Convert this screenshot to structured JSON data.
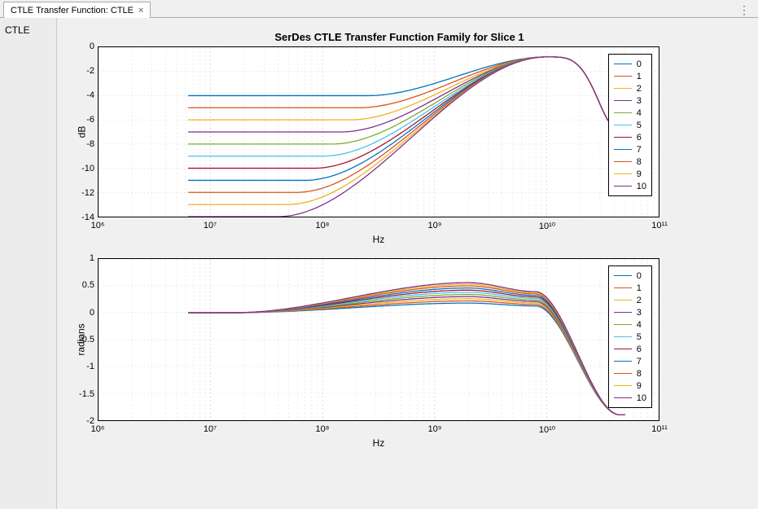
{
  "tab": {
    "title": "CTLE Transfer Function: CTLE"
  },
  "sidebar": {
    "label": "CTLE"
  },
  "title": "SerDes CTLE Transfer Function Family for Slice 1",
  "ylabel_top": "dB",
  "ylabel_bot": "radians",
  "xlabel": "Hz",
  "yticks_top": [
    {
      "v": 0,
      "lbl": "0"
    },
    {
      "v": -2,
      "lbl": "-2"
    },
    {
      "v": -4,
      "lbl": "-4"
    },
    {
      "v": -6,
      "lbl": "-6"
    },
    {
      "v": -8,
      "lbl": "-8"
    },
    {
      "v": -10,
      "lbl": "-10"
    },
    {
      "v": -12,
      "lbl": "-12"
    },
    {
      "v": -14,
      "lbl": "-14"
    }
  ],
  "yticks_bot": [
    {
      "v": 1,
      "lbl": "1"
    },
    {
      "v": 0.5,
      "lbl": "0.5"
    },
    {
      "v": 0,
      "lbl": "0"
    },
    {
      "v": -0.5,
      "lbl": "-0.5"
    },
    {
      "v": -1,
      "lbl": "-1"
    },
    {
      "v": -1.5,
      "lbl": "-1.5"
    },
    {
      "v": -2,
      "lbl": "-2"
    }
  ],
  "xticks": [
    {
      "e": 6,
      "lbl": "10⁶"
    },
    {
      "e": 7,
      "lbl": "10⁷"
    },
    {
      "e": 8,
      "lbl": "10⁸"
    },
    {
      "e": 9,
      "lbl": "10⁹"
    },
    {
      "e": 10,
      "lbl": "10¹⁰"
    },
    {
      "e": 11,
      "lbl": "10¹¹"
    }
  ],
  "legend": [
    "0",
    "1",
    "2",
    "3",
    "4",
    "5",
    "6",
    "7",
    "8",
    "9",
    "10"
  ],
  "colors": [
    "#0072BD",
    "#D95319",
    "#EDB120",
    "#7E2F8E",
    "#77AC30",
    "#4DBEEE",
    "#A2142F",
    "#0072BD",
    "#D95319",
    "#EDB120",
    "#7E2F8E"
  ],
  "chart_data": {
    "type": "line",
    "x_scale": "log",
    "x_range_exp": [
      6,
      11
    ],
    "top": {
      "ylabel": "dB",
      "ylim": [
        -14,
        0
      ],
      "series_dc_dB": [
        -4,
        -5,
        -6,
        -7,
        -8,
        -9,
        -10,
        -11,
        -12,
        -13,
        -14
      ],
      "peak_dB": -0.8,
      "peak_hz": 10000000000.0,
      "rolloff_end_dB": -6.5,
      "rolloff_end_hz": 40000000000.0
    },
    "bot": {
      "ylabel": "radians",
      "ylim": [
        -2,
        1
      ],
      "dc_rad": 0,
      "peak_rad": [
        0.18,
        0.22,
        0.26,
        0.3,
        0.34,
        0.38,
        0.42,
        0.46,
        0.5,
        0.53,
        0.56
      ],
      "peak_hz": 2000000000.0,
      "end_rad": -1.9,
      "end_hz": 45000000000.0
    }
  }
}
